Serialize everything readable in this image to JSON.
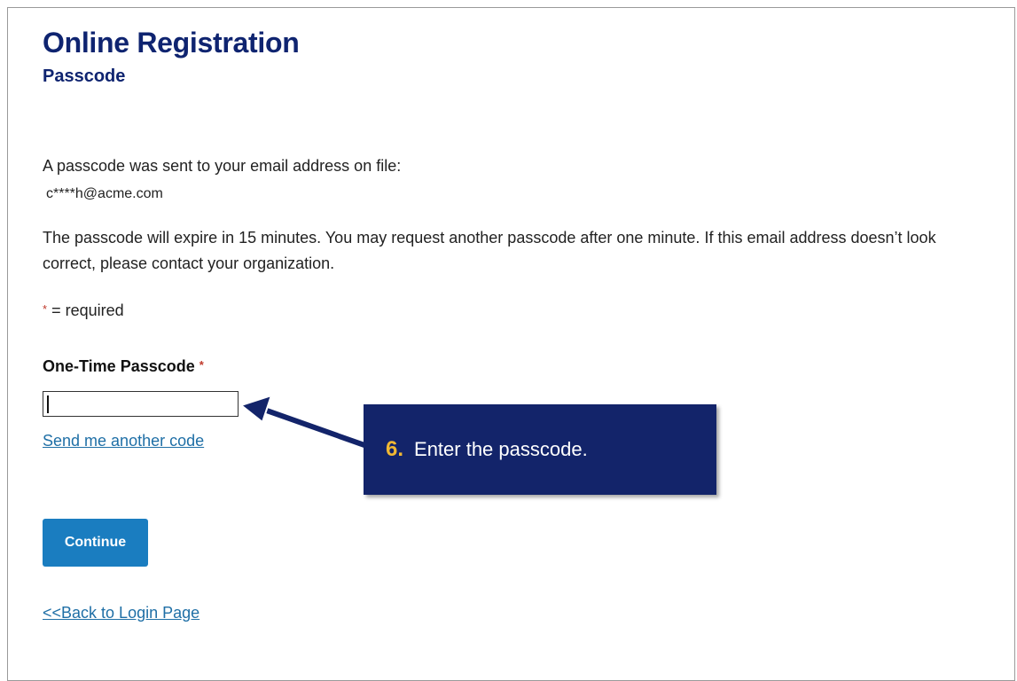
{
  "page": {
    "title": "Online Registration",
    "subtitle": "Passcode"
  },
  "content": {
    "intro": "A passcode was sent to your email address on file:",
    "email": "c****h@acme.com",
    "expiry_note": "The passcode will expire in 15 minutes. You may request another passcode after one minute. If this email address doesn’t look correct, please contact your organization.",
    "required_marker": "*",
    "required_text": " = required"
  },
  "form": {
    "passcode_label": "One-Time Passcode",
    "passcode_value": "",
    "resend_link": "Send me another code",
    "continue_label": "Continue",
    "back_link": "<<Back to Login Page"
  },
  "callout": {
    "step": "6.",
    "text": "Enter the passcode."
  },
  "colors": {
    "heading": "#0f2470",
    "link": "#1f6fa6",
    "button": "#1a7dc0",
    "callout_bg": "#13246a",
    "step_accent": "#f1b833",
    "required": "#c0392b"
  }
}
